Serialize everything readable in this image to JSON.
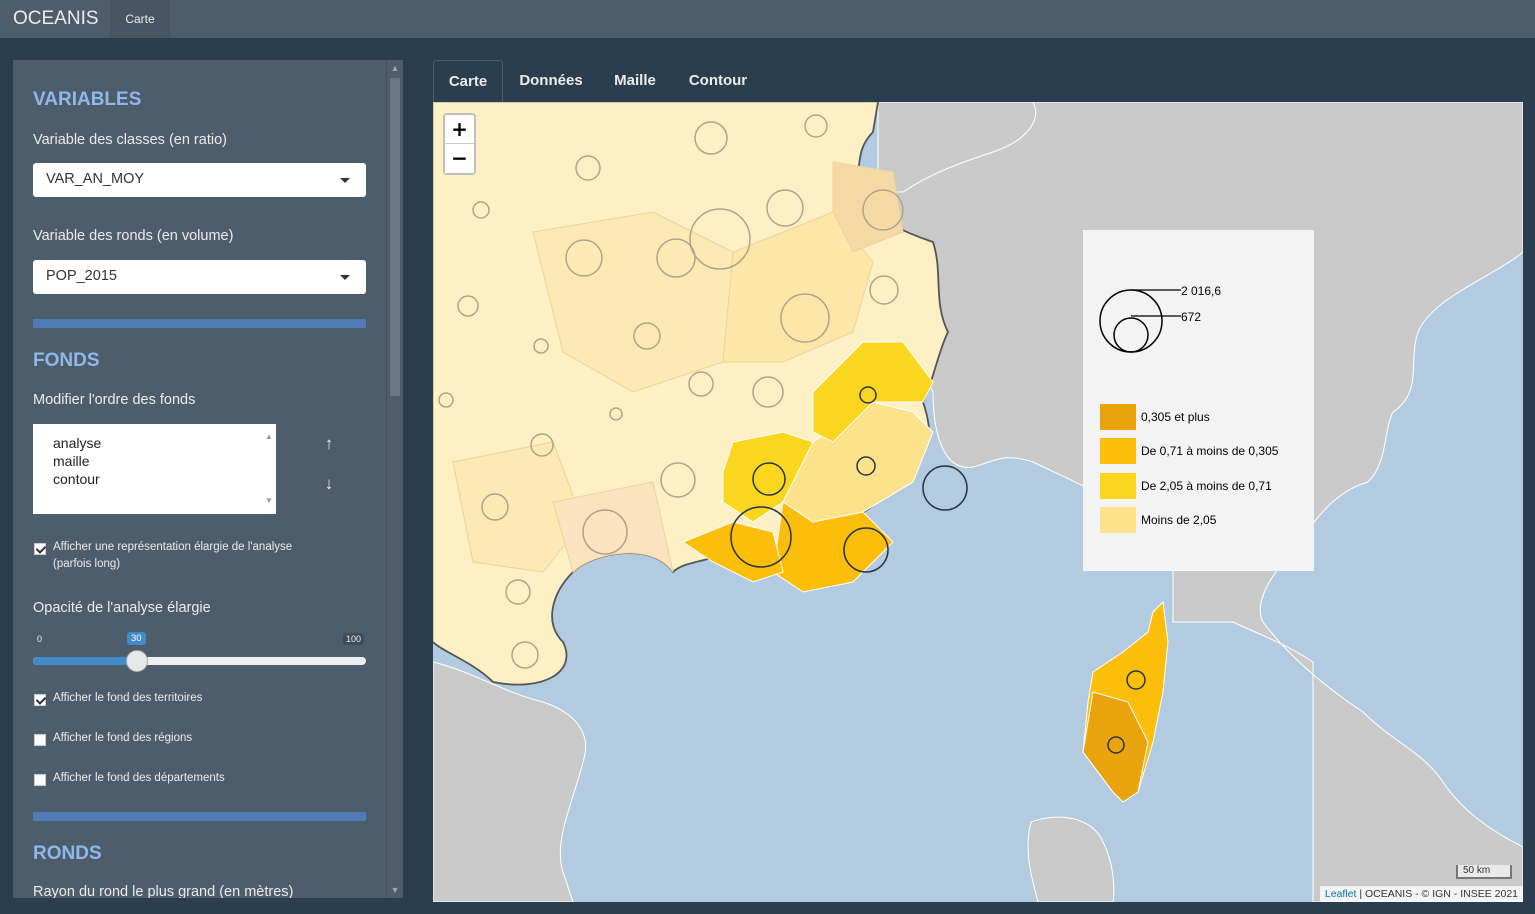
{
  "app": {
    "brand": "OCEANIS",
    "nav_tab": "Carte"
  },
  "sidebar": {
    "variables_title": "VARIABLES",
    "var_classes_label": "Variable des classes (en ratio)",
    "var_classes_value": "VAR_AN_MOY",
    "var_ronds_label": "Variable des ronds (en volume)",
    "var_ronds_value": "POP_2015",
    "fonds_title": "FONDS",
    "order_label": "Modifier l'ordre des fonds",
    "order_items": [
      "analyse",
      "maille",
      "contour"
    ],
    "elargie_label": "Afficher une représentation élargie de l'analyse (parfois long)",
    "elargie_checked": true,
    "opacity_label": "Opacité de l'analyse élargie",
    "opacity_min": "0",
    "opacity_value": "30",
    "opacity_max": "100",
    "opacity_fraction": 0.3,
    "territoires_label": "Afficher le fond des territoires",
    "territoires_checked": true,
    "regions_label": "Afficher le fond des régions",
    "regions_checked": false,
    "departements_label": "Afficher le fond des départements",
    "departements_checked": false,
    "ronds_title": "RONDS",
    "rayon_label": "Rayon du rond le plus grand (en mètres)"
  },
  "tabs": [
    "Carte",
    "Données",
    "Maille",
    "Contour"
  ],
  "active_tab": "Carte",
  "map": {
    "zoom_in": "+",
    "zoom_out": "−",
    "legend": {
      "circle_max": "2 016,6",
      "circle_min": "672",
      "classes": [
        {
          "label": "0,305 et plus",
          "color": "#e8a30d"
        },
        {
          "label": "De 0,71 à moins de 0,305",
          "color": "#fbbf0b"
        },
        {
          "label": "De 2,05 à moins de 0,71",
          "color": "#fad71e"
        },
        {
          "label": "Moins de 2,05",
          "color": "#fde28c"
        }
      ]
    },
    "scale": "50 km",
    "attribution_leaflet": "Leaflet",
    "attribution_rest": " | OCEANIS - © IGN - INSEE 2021"
  },
  "colors": {
    "sea": "#b3cbe0",
    "land": "#c9c9c9",
    "pale": "#fdf0c4",
    "accent": "#8fb8e8"
  }
}
